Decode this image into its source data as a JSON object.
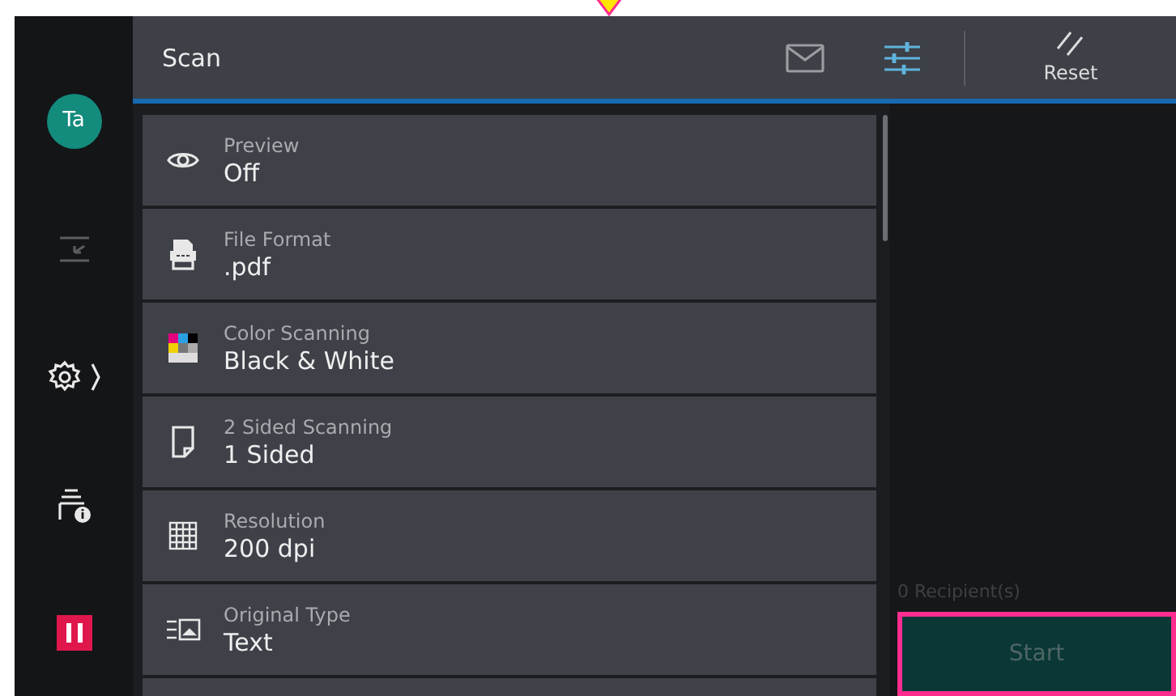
{
  "sidebar": {
    "avatar": "Ta",
    "items": [
      {
        "kind": "transfer",
        "disabled": true
      },
      {
        "kind": "settings",
        "disabled": false
      },
      {
        "kind": "device-info",
        "disabled": false
      },
      {
        "kind": "pause",
        "disabled": false
      }
    ]
  },
  "header": {
    "title": "Scan",
    "actions": [
      {
        "kind": "mail",
        "selected": false
      },
      {
        "kind": "adjust",
        "selected": true
      }
    ],
    "reset": "Reset"
  },
  "settings": [
    {
      "kind": "preview",
      "label": "Preview",
      "value": "Off"
    },
    {
      "kind": "format",
      "label": "File Format",
      "value": ".pdf"
    },
    {
      "kind": "color",
      "label": "Color Scanning",
      "value": "Black & White"
    },
    {
      "kind": "sides",
      "label": "2 Sided Scanning",
      "value": "1 Sided"
    },
    {
      "kind": "resolution",
      "label": "Resolution",
      "value": "200 dpi"
    },
    {
      "kind": "type",
      "label": "Original Type",
      "value": "Text"
    }
  ],
  "recipients": "0 Recipient(s)",
  "start": {
    "label": "Start",
    "disabled": true,
    "highlighted": true
  }
}
